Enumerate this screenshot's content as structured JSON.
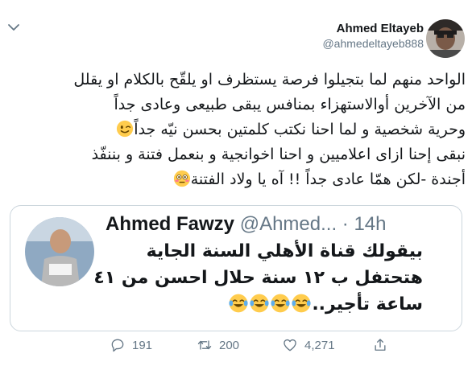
{
  "header": {
    "name": "Ahmed Eltayeb",
    "handle": "@ahmedeltayeb888",
    "menu_icon": "chevron-down-icon"
  },
  "tweet": {
    "lines": [
      "الواحد منهم لما بتجيلوا فرصة يستظرف او يلقّح بالكلام او يقلل",
      "من الآخرين أوالاستهزاء بمنافس يبقى طبيعى وعادى جداً",
      "وحرية شخصية و لما احنا نكتب كلمتين بحسن نيّه جداً",
      "نبقى إحنا ازاى اعلاميين و احنا اخوانجية و بنعمل فتنة و بننفّذ",
      "أجندة  -لكن همّا عادى جداً  !! آه يا ولاد الفتنة"
    ],
    "emoji": {
      "line3": "winking-face",
      "line5": "flushed-face"
    }
  },
  "quoted": {
    "name": "Ahmed Fawzy",
    "handle": "@Ahmed...",
    "time": "· 14h",
    "lines": [
      "بيقولك قناة الأهلي السنة الجاية",
      "هتحتفل ب ١٢ سنة حلال احسن من ٤١",
      "ساعة تأجير.."
    ],
    "emoji": "face-with-tears-of-joy",
    "emoji_count": 4
  },
  "actions": {
    "replies": "191",
    "retweets": "200",
    "likes": "4,271"
  },
  "colors": {
    "text": "#14171a",
    "secondary": "#657786",
    "border": "#ccd6dd",
    "emoji_yellow": "#ffcc4d",
    "tears_blue": "#5dadec"
  }
}
